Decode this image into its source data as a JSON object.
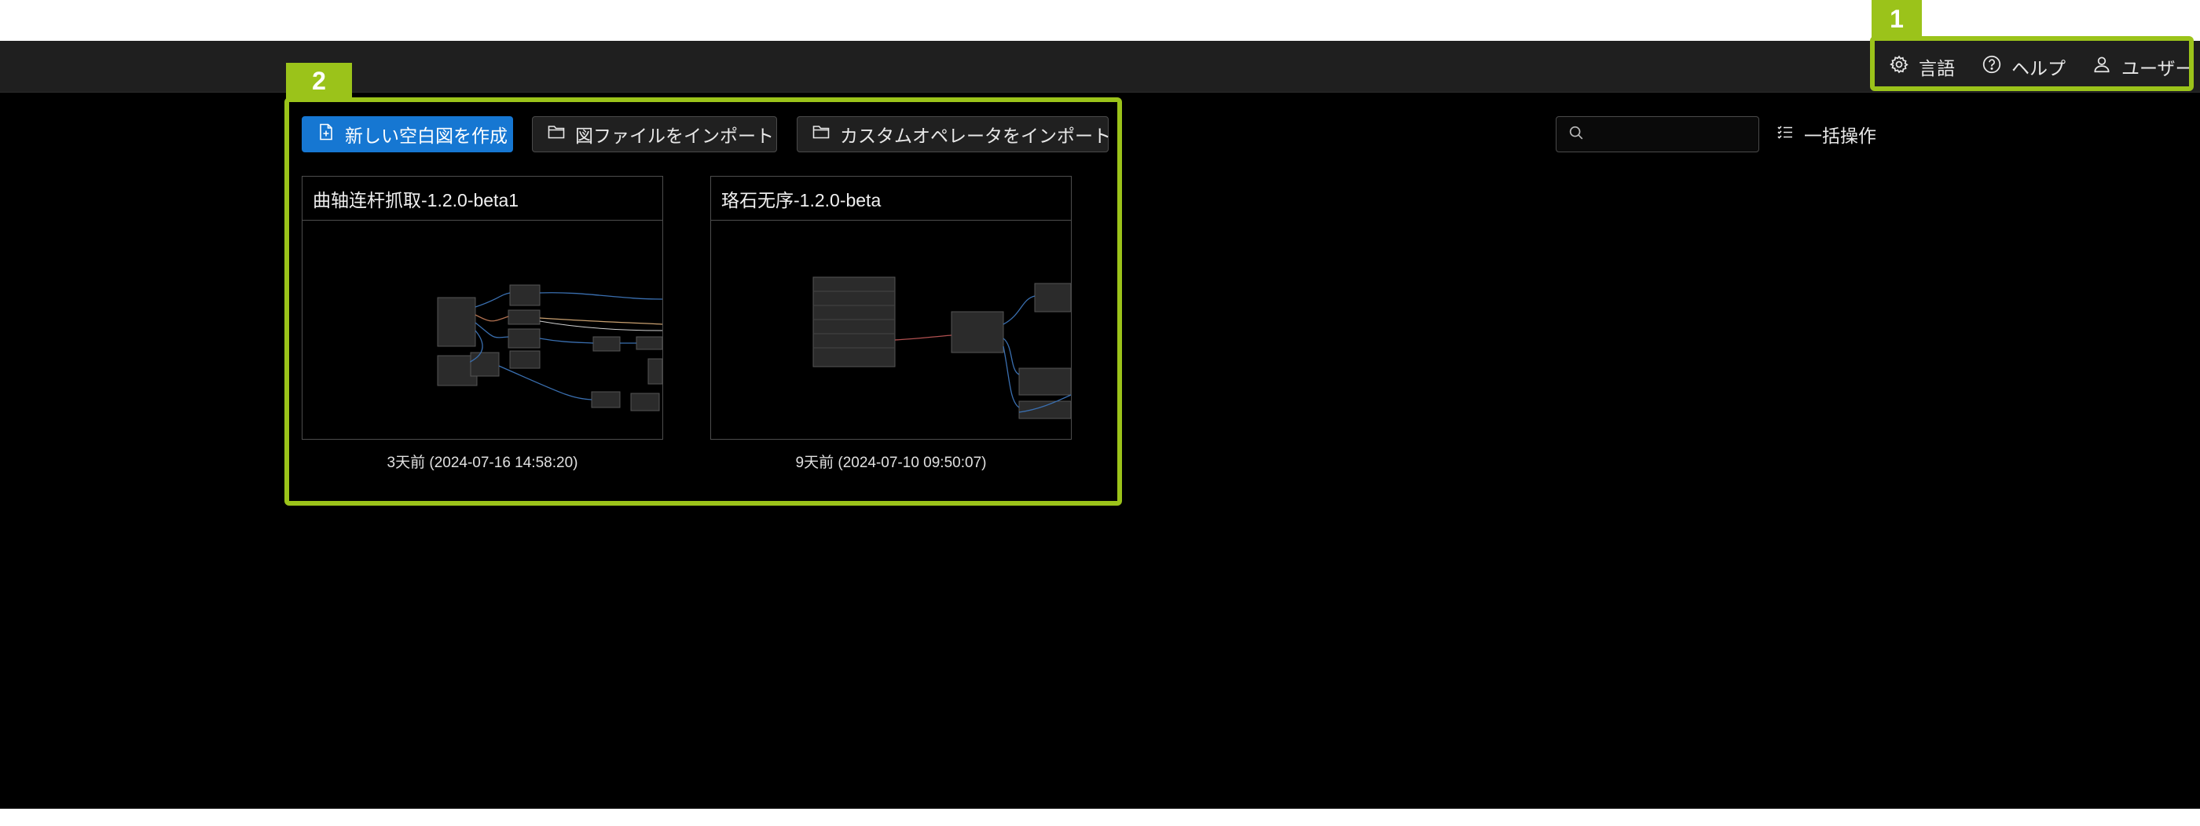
{
  "header": {
    "items": [
      {
        "label": "言語",
        "icon": "gear-icon"
      },
      {
        "label": "ヘルプ",
        "icon": "help-circle-icon"
      },
      {
        "label": "ユーザー",
        "icon": "user-icon"
      }
    ]
  },
  "toolbar": {
    "new_blank": "新しい空白図を作成",
    "import_file": "図ファイルをインポート",
    "import_operator": "カスタムオペレータをインポート",
    "search_placeholder": "",
    "bulk_action": "一括操作"
  },
  "cards": [
    {
      "title": "曲轴连杆抓取-1.2.0-beta1",
      "time": "3天前 (2024-07-16 14:58:20)"
    },
    {
      "title": "珞石无序-1.2.0-beta",
      "time": "9天前 (2024-07-10 09:50:07)"
    }
  ],
  "annotations": [
    {
      "number": "1"
    },
    {
      "number": "2"
    }
  ],
  "colors": {
    "accent": "#1677d2",
    "annotation": "#9bc31a",
    "background": "#000000",
    "header": "#1f1f1f"
  }
}
